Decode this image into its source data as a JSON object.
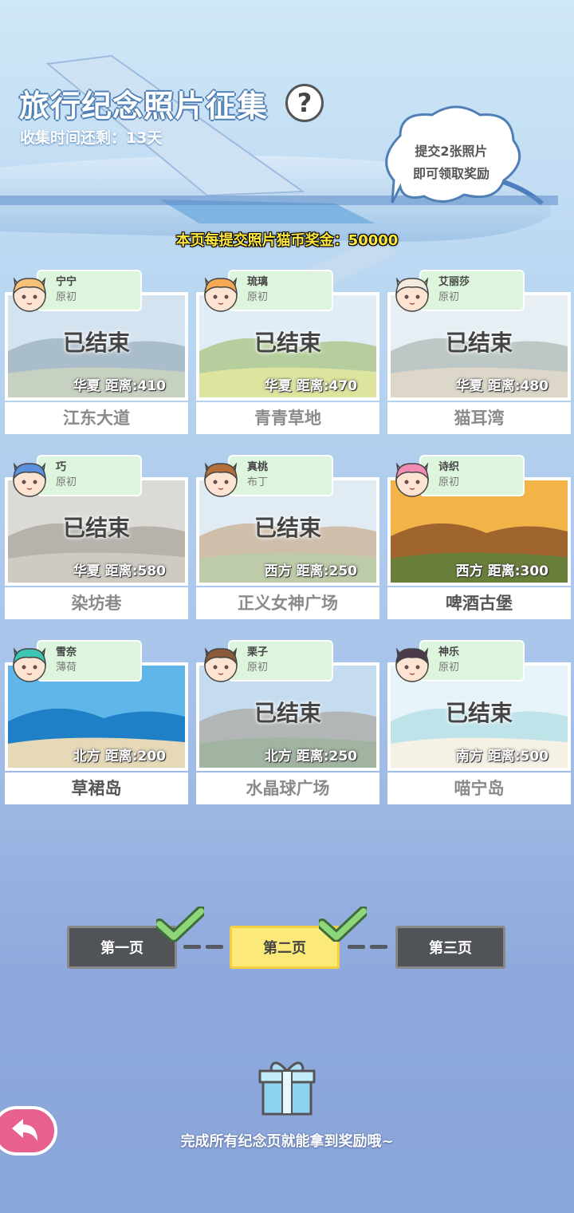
{
  "header": {
    "title": "旅行纪念照片征集",
    "help_label": "?",
    "time_left": "收集时间还剩：13天",
    "bubble_line1": "提交2张照片",
    "bubble_line2": "即可领取奖励",
    "bonus_text": "本页每提交照片猫币奖金：50000"
  },
  "ended_label": "已结束",
  "cards": [
    {
      "char": "宁宁",
      "variant": "原初",
      "distance": "华夏  距离:410",
      "place": "江东大道"
    },
    {
      "char": "琉璃",
      "variant": "原初",
      "distance": "华夏  距离:470",
      "place": "青青草地"
    },
    {
      "char": "艾丽莎",
      "variant": "原初",
      "distance": "华夏  距离:480",
      "place": "猫耳湾"
    },
    {
      "char": "巧",
      "variant": "原初",
      "distance": "华夏  距离:580",
      "place": "染坊巷"
    },
    {
      "char": "真桃",
      "variant": "布丁",
      "distance": "西方  距离:250",
      "place": "正义女神广场"
    },
    {
      "char": "诗织",
      "variant": "原初",
      "distance": "西方  距离:300",
      "place": "啤酒古堡"
    },
    {
      "char": "雪奈",
      "variant": "薄荷",
      "distance": "北方  距离:200",
      "place": "草裙岛"
    },
    {
      "char": "栗子",
      "variant": "原初",
      "distance": "北方  距离:250",
      "place": "水晶球广场"
    },
    {
      "char": "神乐",
      "variant": "原初",
      "distance": "南方  距离:500",
      "place": "喵宁岛"
    }
  ],
  "pages": {
    "page1": "第一页",
    "page2": "第二页",
    "page3": "第三页"
  },
  "footer": {
    "text": "完成所有纪念页就能拿到奖励哦~"
  },
  "icons": {
    "help": "question-icon",
    "back": "back-arrow-icon",
    "gift": "gift-icon",
    "check": "checkmark-icon"
  },
  "colors": {
    "accent_yellow": "#fbe97a",
    "tag_green": "#ddf5dc",
    "back_pink": "#e8608e",
    "check_green": "#8ed67a"
  }
}
